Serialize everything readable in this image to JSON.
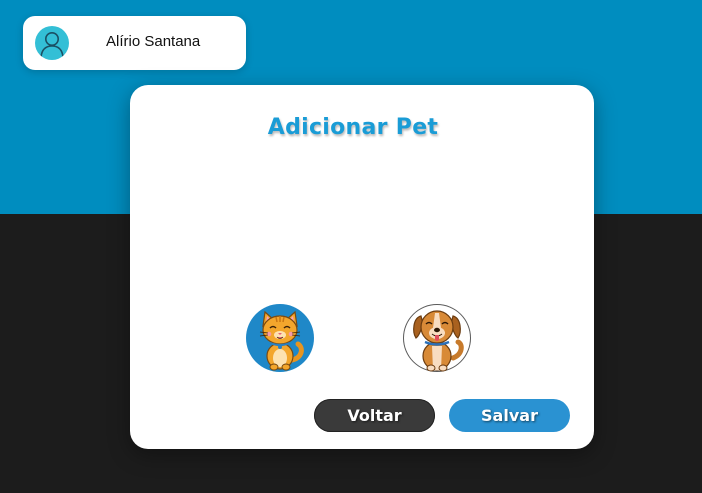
{
  "user": {
    "name": "Alírio Santana",
    "avatar_icon": "user-icon"
  },
  "dialog": {
    "title": "Adicionar Pet"
  },
  "pets": [
    {
      "icon": "cat-icon"
    },
    {
      "icon": "dog-icon"
    }
  ],
  "buttons": {
    "back_label": "Voltar",
    "save_label": "Salvar"
  },
  "colors": {
    "brand_blue": "#008dbf",
    "dark_background": "#1c1c1c",
    "title_blue": "#1a9cd6",
    "save_button": "#2a92d2",
    "back_button": "#3a3a3a",
    "avatar_bg": "#33bfd6"
  }
}
